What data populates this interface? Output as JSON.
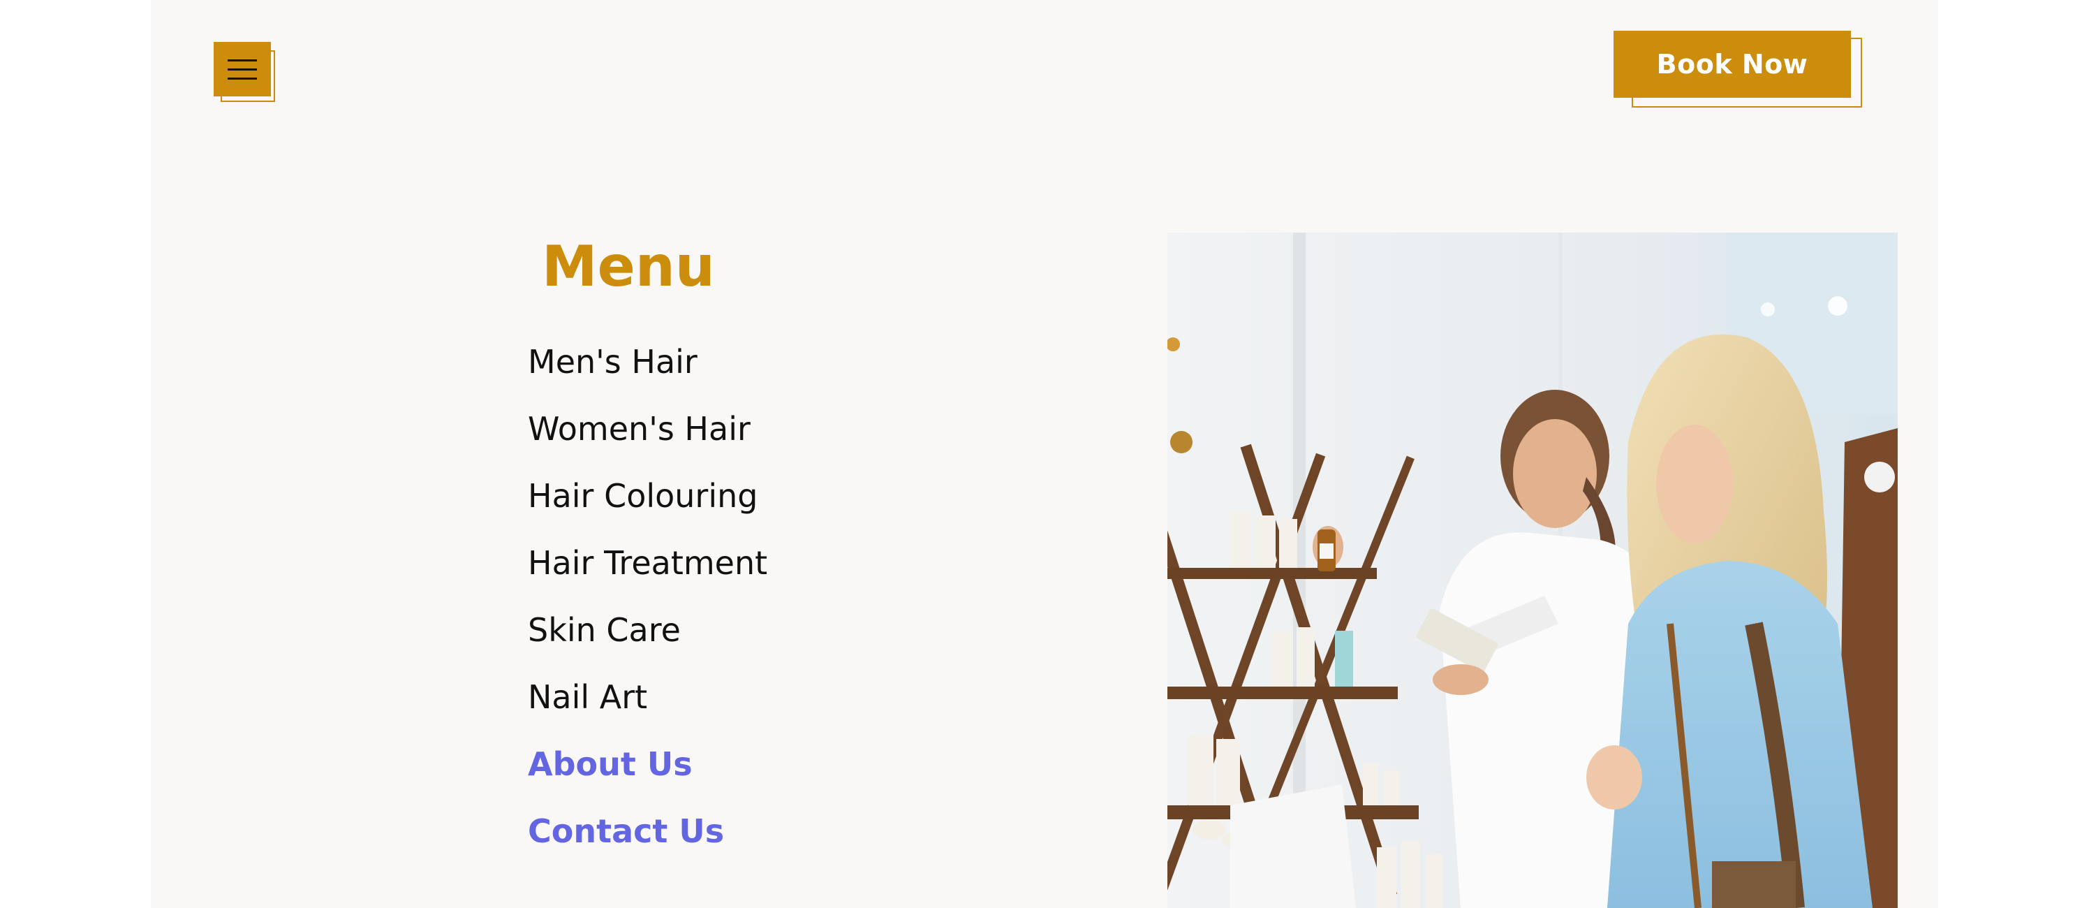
{
  "header": {
    "menu_icon": "hamburger-menu-icon",
    "book_now_label": "Book Now"
  },
  "menu": {
    "title": "Menu",
    "items": [
      {
        "label": "Men's Hair"
      },
      {
        "label": "Women's Hair"
      },
      {
        "label": "Hair Colouring"
      },
      {
        "label": "Hair Treatment"
      },
      {
        "label": "Skin Care"
      },
      {
        "label": "Nail Art"
      },
      {
        "label": "About Us"
      },
      {
        "label": "Contact Us"
      }
    ]
  },
  "colors": {
    "accent": "#cc8c0c",
    "link": "#6366e0",
    "background": "#f9f8f6",
    "text": "#111111"
  }
}
